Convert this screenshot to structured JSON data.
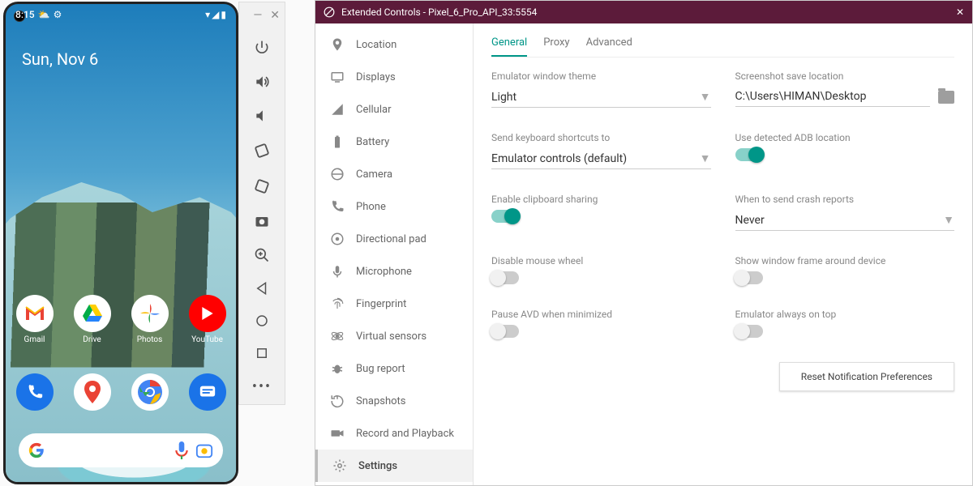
{
  "device": {
    "status_time": "8:15",
    "date_text": "Sun, Nov 6",
    "apps_row1": [
      {
        "name": "Gmail"
      },
      {
        "name": "Drive"
      },
      {
        "name": "Photos"
      },
      {
        "name": "YouTube"
      }
    ]
  },
  "emu_toolbar": {
    "icons": [
      "power",
      "volume-up",
      "volume-down",
      "rotate-left",
      "rotate-right",
      "camera",
      "zoom",
      "back",
      "home",
      "overview",
      "more"
    ]
  },
  "ext": {
    "title": "Extended Controls - Pixel_6_Pro_API_33:5554",
    "side_items": [
      "Location",
      "Displays",
      "Cellular",
      "Battery",
      "Camera",
      "Phone",
      "Directional pad",
      "Microphone",
      "Fingerprint",
      "Virtual sensors",
      "Bug report",
      "Snapshots",
      "Record and Playback",
      "Settings"
    ],
    "side_selected": "Settings",
    "tabs": [
      "General",
      "Proxy",
      "Advanced"
    ],
    "tab_active": "General",
    "settings": {
      "theme_label": "Emulator window theme",
      "theme_value": "Light",
      "screenshot_label": "Screenshot save location",
      "screenshot_value": "C:\\Users\\HIMAN\\Desktop",
      "kb_label": "Send keyboard shortcuts to",
      "kb_value": "Emulator controls (default)",
      "adb_label": "Use detected ADB location",
      "adb_on": true,
      "clip_label": "Enable clipboard sharing",
      "clip_on": true,
      "crash_label": "When to send crash reports",
      "crash_value": "Never",
      "wheel_label": "Disable mouse wheel",
      "wheel_on": false,
      "frame_label": "Show window frame around device",
      "frame_on": false,
      "pause_label": "Pause AVD when minimized",
      "pause_on": false,
      "ontop_label": "Emulator always on top",
      "ontop_on": false,
      "reset_btn": "Reset Notification Preferences"
    }
  }
}
